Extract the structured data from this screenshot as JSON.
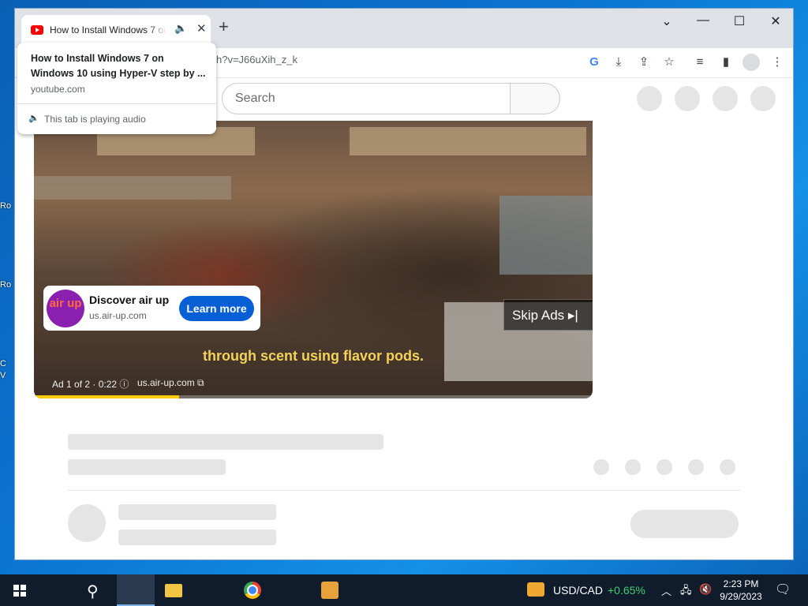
{
  "desktop": {
    "fragments": [
      "Ro",
      "Ro",
      "C",
      "V"
    ]
  },
  "browser": {
    "tab_title": "How to Install Windows 7 on Windows 10 using Hyper-V step by step",
    "tab_audio_icon": "speaker-icon",
    "url": "h?v=J66uXih_z_k",
    "hover_card": {
      "title": "How to Install Windows 7 on Windows 10 using Hyper-V step by ...",
      "domain": "youtube.com",
      "audio_note": "This tab is playing audio"
    },
    "window_controls": {
      "minimize": "—",
      "maximize": "☐",
      "close": "✕",
      "tab_search": "⌄"
    }
  },
  "youtube": {
    "search_placeholder": "Search"
  },
  "ad": {
    "brand_logo_text": "air up",
    "title": "Discover air up",
    "domain": "us.air-up.com",
    "cta": "Learn more",
    "caption": "through scent using flavor pods.",
    "skip": "Skip Ads",
    "info": "Ad 1 of 2 · 0:22",
    "info_domain": "us.air-up.com",
    "progress": 0.26,
    "accent": "#ffcc00"
  },
  "taskbar": {
    "currency_pair": "USD/CAD",
    "currency_change": "+0.65%",
    "time": "2:23 PM",
    "date": "9/29/2023"
  }
}
